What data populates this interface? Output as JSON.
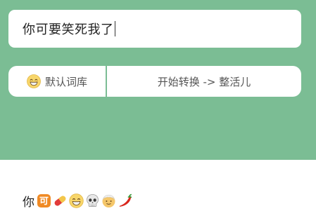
{
  "input": {
    "value": "你可要笑死我了"
  },
  "buttons": {
    "dictionary_label": "默认词库",
    "dictionary_icon": "grinning-face-icon",
    "convert_label": "开始转换 -> 整活儿"
  },
  "output": {
    "leading_text": "你",
    "emojis": [
      "squared-ke-icon",
      "pill-icon",
      "grinning-face-icon",
      "skull-icon",
      "older-person-icon",
      "hot-pepper-icon"
    ]
  },
  "colors": {
    "header_background": "#7bbd94",
    "card_background": "#ffffff"
  }
}
